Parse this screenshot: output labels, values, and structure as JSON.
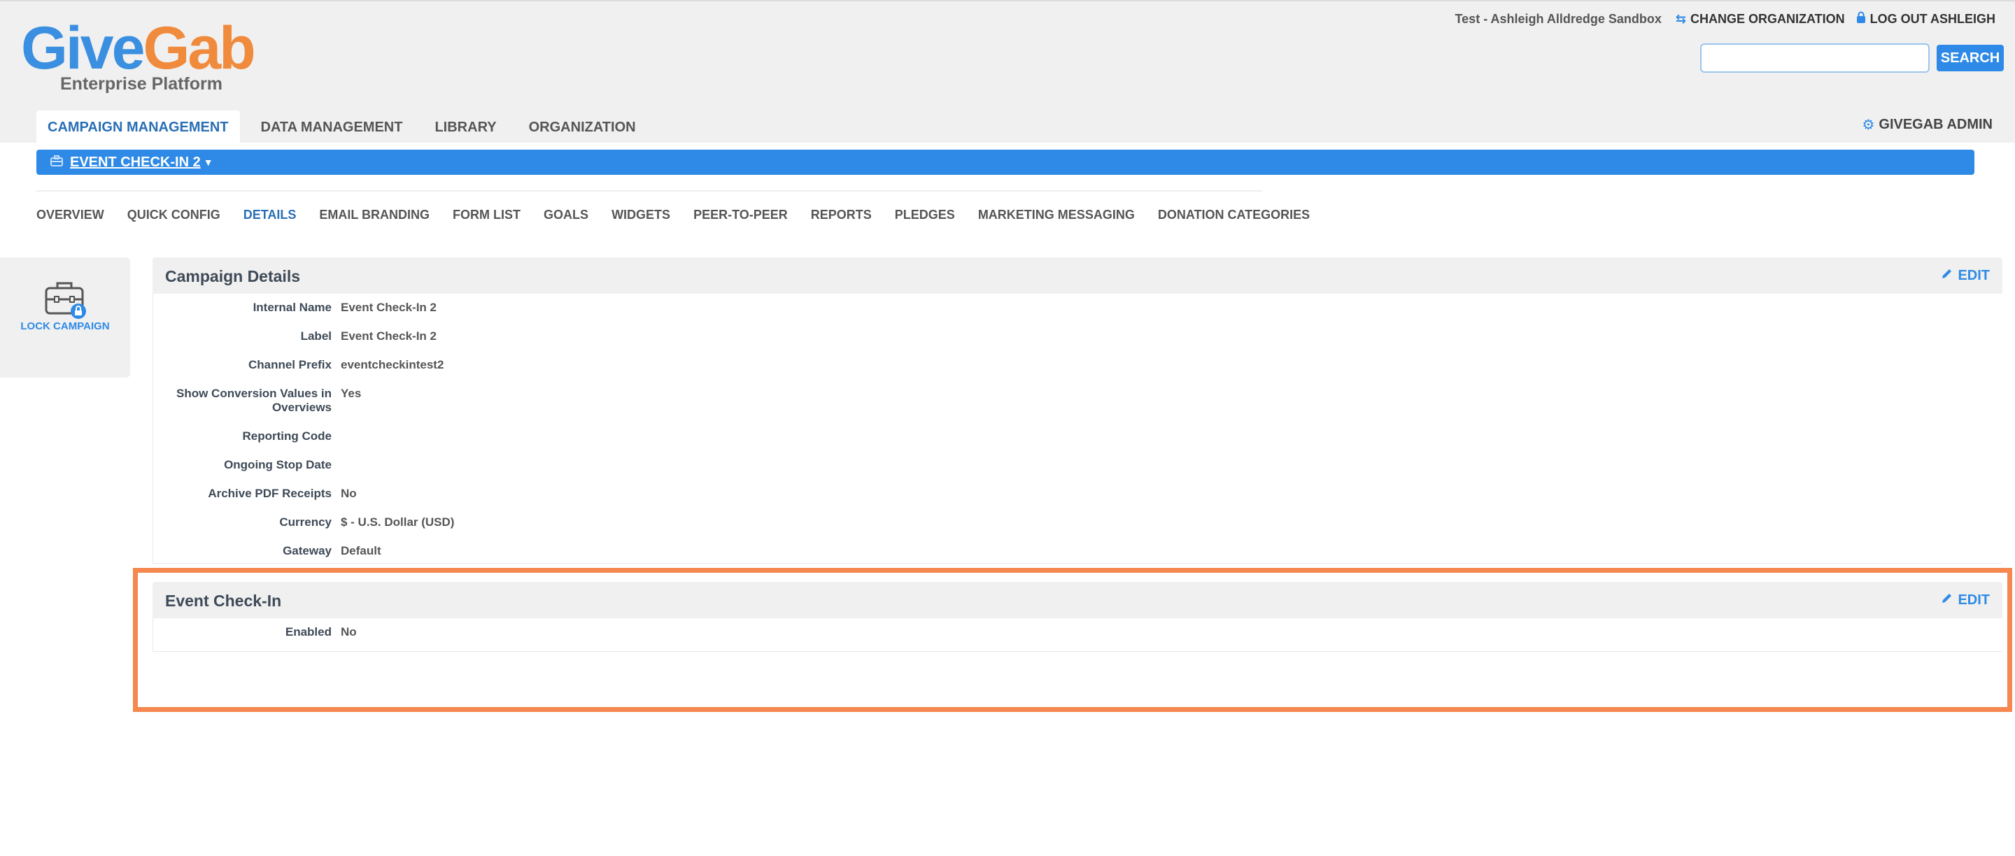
{
  "brand": {
    "logo_part1": "Give",
    "logo_part2": "Gab",
    "subtitle": "Enterprise Platform",
    "colors": {
      "blue": "#2e8ae6",
      "orange": "#f08a3c",
      "highlight": "#f5874f"
    }
  },
  "top_bar": {
    "org_name": "Test - Ashleigh Alldredge Sandbox",
    "change_org": "CHANGE ORGANIZATION",
    "change_org_icon": "swap-icon",
    "logout": "LOG OUT ASHLEIGH",
    "logout_icon": "lock-icon",
    "search_placeholder": "",
    "search_value": "",
    "search_button": "SEARCH"
  },
  "main_nav": {
    "tabs": [
      {
        "label": "CAMPAIGN MANAGEMENT",
        "active": true
      },
      {
        "label": "DATA MANAGEMENT",
        "active": false
      },
      {
        "label": "LIBRARY",
        "active": false
      },
      {
        "label": "ORGANIZATION",
        "active": false
      }
    ],
    "admin": "GIVEGAB ADMIN",
    "admin_icon": "gear-icon"
  },
  "campaign_bar": {
    "name": "EVENT CHECK-IN 2",
    "icon": "briefcase-icon"
  },
  "sub_nav": {
    "items": [
      {
        "label": "OVERVIEW",
        "active": false
      },
      {
        "label": "QUICK CONFIG",
        "active": false
      },
      {
        "label": "DETAILS",
        "active": true
      },
      {
        "label": "EMAIL BRANDING",
        "active": false
      },
      {
        "label": "FORM LIST",
        "active": false
      },
      {
        "label": "GOALS",
        "active": false
      },
      {
        "label": "WIDGETS",
        "active": false
      },
      {
        "label": "PEER-TO-PEER",
        "active": false
      },
      {
        "label": "REPORTS",
        "active": false
      },
      {
        "label": "PLEDGES",
        "active": false
      },
      {
        "label": "MARKETING MESSAGING",
        "active": false
      },
      {
        "label": "DONATION CATEGORIES",
        "active": false
      }
    ]
  },
  "side_panel": {
    "lock_label": "LOCK CAMPAIGN",
    "icon": "locked-briefcase-icon"
  },
  "campaign_details": {
    "title": "Campaign Details",
    "edit": "EDIT",
    "rows": [
      {
        "label": "Internal Name",
        "value": "Event Check-In 2"
      },
      {
        "label": "Label",
        "value": "Event Check-In 2"
      },
      {
        "label": "Channel Prefix",
        "value": "eventcheckintest2"
      },
      {
        "label": "Show Conversion Values in Overviews",
        "value": "Yes"
      },
      {
        "label": "Reporting Code",
        "value": ""
      },
      {
        "label": "Ongoing Stop Date",
        "value": ""
      },
      {
        "label": "Archive PDF Receipts",
        "value": "No"
      },
      {
        "label": "Currency",
        "value": "$ - U.S. Dollar (USD)"
      },
      {
        "label": "Gateway",
        "value": "Default"
      }
    ]
  },
  "event_checkin": {
    "title": "Event Check-In",
    "edit": "EDIT",
    "rows": [
      {
        "label": "Enabled",
        "value": "No"
      }
    ]
  }
}
